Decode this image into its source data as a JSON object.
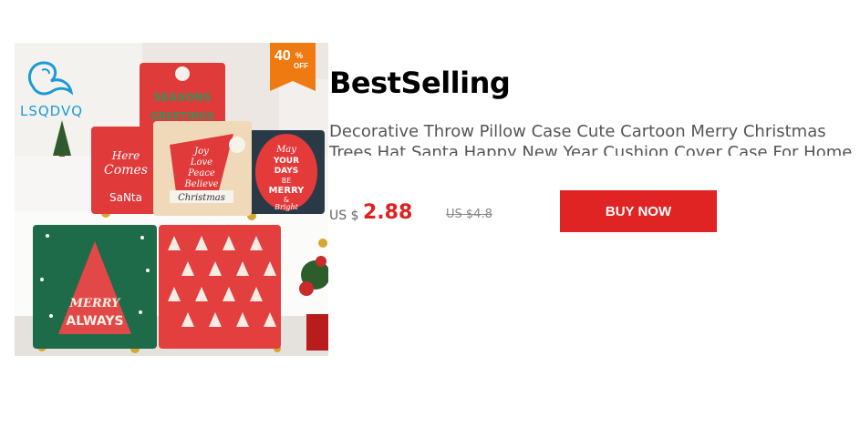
{
  "brand": {
    "name": "LSQDVQ",
    "logo_icon": "bird-logo-icon",
    "color": "#1c9ad6"
  },
  "badge": {
    "number": "40",
    "percent": "%",
    "off": "OFF",
    "color": "#f07a12"
  },
  "section": {
    "title": "BestSelling"
  },
  "product": {
    "description": "Decorative Throw Pillow Case Cute Cartoon Merry Christmas Trees Hat Santa Happy New Year Cushion Cover Case For Home Sofa",
    "image_texts": {
      "pillow_1": [
        "SEASONS",
        "GREETINGS"
      ],
      "pillow_2": [
        "Here",
        "Comes",
        "SaNta"
      ],
      "pillow_3": [
        "Joy",
        "Love",
        "Peace",
        "Believe",
        "Christmas"
      ],
      "pillow_4": [
        "May",
        "YOUR",
        "DAYS",
        "BE",
        "MERRY",
        "&",
        "Bright"
      ],
      "pillow_5": [
        "MERRY",
        "ALWAYS"
      ]
    }
  },
  "price": {
    "currency": "US $",
    "value": "2.88",
    "old": "US $4.8"
  },
  "cta": {
    "label": "BUY NOW",
    "color": "#e02323"
  }
}
